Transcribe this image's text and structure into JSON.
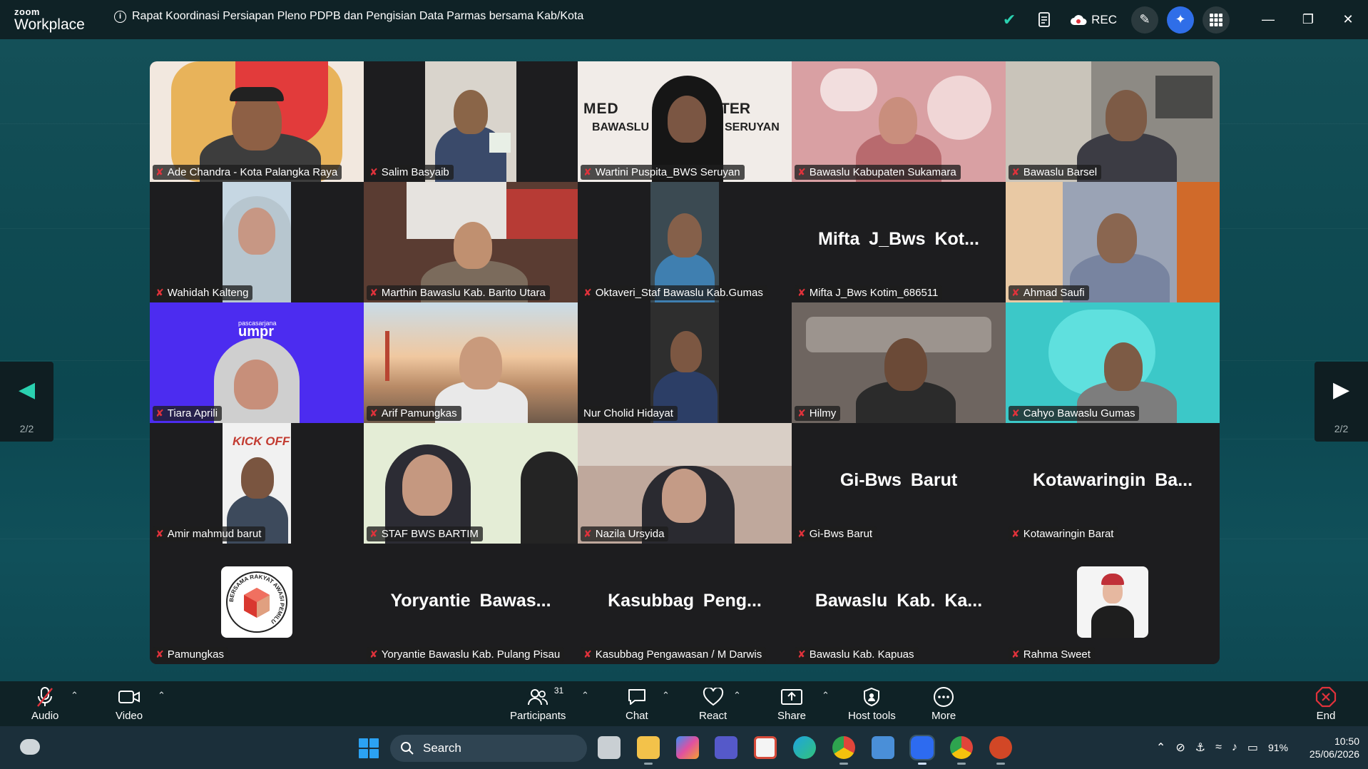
{
  "app": {
    "brand_top": "zoom",
    "brand_bottom": "Workplace"
  },
  "meeting": {
    "title": "Rapat Koordinasi Persiapan Pleno PDPB dan Pengisian Data Parmas bersama Kab/Kota",
    "rec_label": "REC"
  },
  "pager": {
    "page_label": "2/2"
  },
  "tiles": [
    {
      "name": "Ade Chandra - Kota Palangka Raya",
      "muted": true
    },
    {
      "name": "Salim Basyaib",
      "muted": true
    },
    {
      "name": "Wartini Puspita_BWS Seruyan",
      "muted": true
    },
    {
      "name": "Bawaslu Kabupaten Sukamara",
      "muted": true
    },
    {
      "name": "Bawaslu Barsel",
      "muted": true
    },
    {
      "name": "Wahidah Kalteng",
      "muted": true
    },
    {
      "name": "Marthin Bawaslu Kab. Barito Utara",
      "muted": true
    },
    {
      "name": "Oktaveri_Staf Bawaslu Kab.Gumas",
      "muted": true
    },
    {
      "name": "Mifta J_Bws Kotim_686511",
      "muted": true,
      "display": "Mifta J_Bws Kot..."
    },
    {
      "name": "Ahmad Saufi",
      "muted": true
    },
    {
      "name": "Tiara Aprili",
      "muted": true
    },
    {
      "name": "Arif Pamungkas",
      "muted": true
    },
    {
      "name": "Nur Cholid Hidayat",
      "muted": false
    },
    {
      "name": "Hilmy",
      "muted": true
    },
    {
      "name": "Cahyo Bawaslu Gumas",
      "muted": true
    },
    {
      "name": "Amir mahmud barut",
      "muted": true
    },
    {
      "name": "STAF BWS BARTIM",
      "muted": true
    },
    {
      "name": "Nazila Ursyida",
      "muted": true
    },
    {
      "name": "Gi-Bws Barut",
      "muted": true,
      "display": "Gi-Bws Barut"
    },
    {
      "name": "Kotawaringin Barat",
      "muted": true,
      "display": "Kotawaringin Ba..."
    },
    {
      "name": "Pamungkas",
      "muted": true
    },
    {
      "name": "Yoryantie Bawaslu Kab. Pulang Pisau",
      "muted": true,
      "display": "Yoryantie Bawas..."
    },
    {
      "name": "Kasubbag Pengawasan / M Darwis",
      "muted": true,
      "display": "Kasubbag Peng..."
    },
    {
      "name": "Bawaslu Kab. Kapuas",
      "muted": true,
      "display": "Bawaslu Kab. Ka..."
    },
    {
      "name": "Rahma Sweet",
      "muted": true
    }
  ],
  "video_text": {
    "banner_left": "MED",
    "banner_right": "TER",
    "org_left": "BAWASLU",
    "org_right": "SERUYAN",
    "logo_small": "pascasarjana",
    "logo_big": "umpr",
    "poster": "KICK OFF",
    "logo_ring": "BERSAMA RAKYAT AWASI PEMILU"
  },
  "toolbar": {
    "audio": "Audio",
    "video": "Video",
    "participants": "Participants",
    "participants_count": "31",
    "chat": "Chat",
    "react": "React",
    "share": "Share",
    "host_tools": "Host tools",
    "more": "More",
    "end": "End"
  },
  "taskbar": {
    "search_placeholder": "Search",
    "battery": "91%",
    "time": "10:50",
    "date": "25/06/2026"
  },
  "colors": {
    "accent": "#2ad1b0",
    "muted_mic": "#e0323b",
    "ai_button": "#2f6ee8",
    "stage": "#0d3f47"
  }
}
